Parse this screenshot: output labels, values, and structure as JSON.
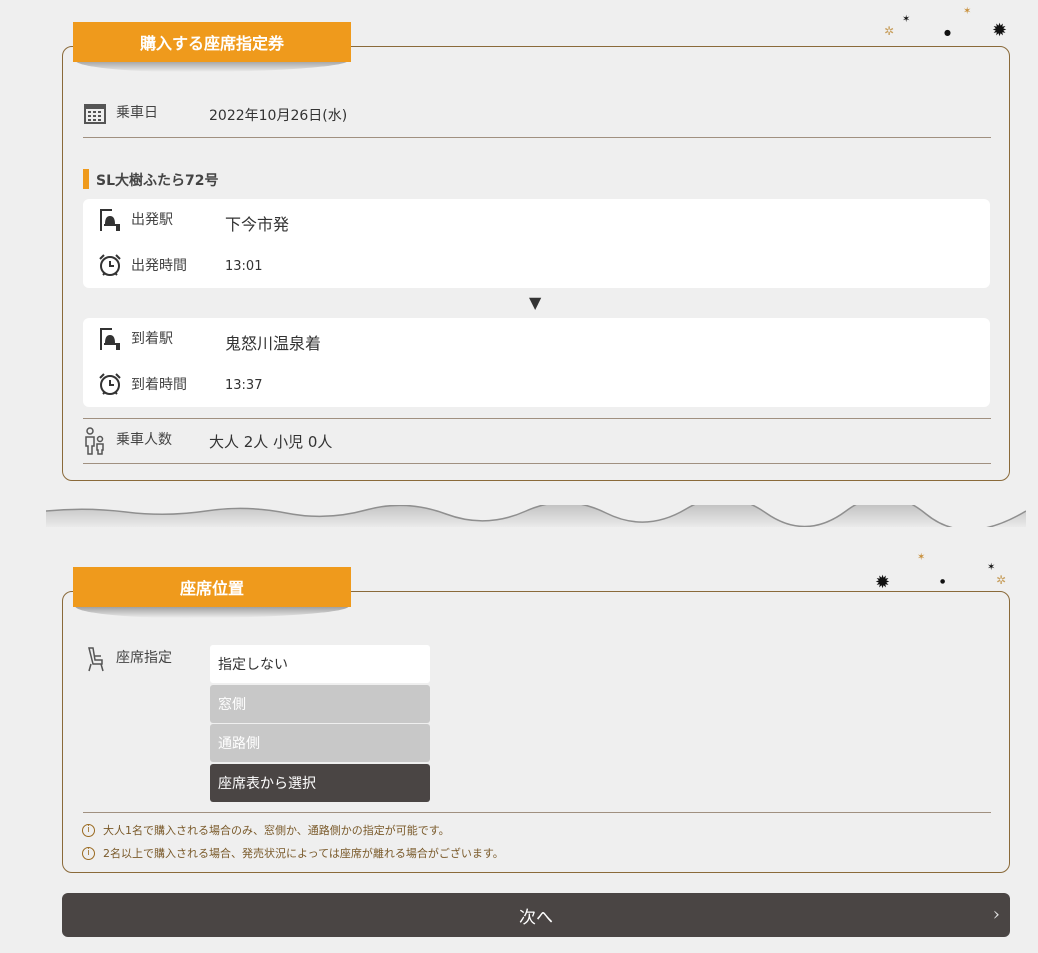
{
  "section1": {
    "tab_title": "購入する座席指定券",
    "ride_date_label": "乗車日",
    "ride_date_value": "2022年10月26日(水)",
    "train_name": "SL大樹ふたら72号",
    "departure_station_label": "出発駅",
    "departure_station_value": "下今市発",
    "departure_time_label": "出発時間",
    "departure_time_value": "13:01",
    "arrival_station_label": "到着駅",
    "arrival_station_value": "鬼怒川温泉着",
    "arrival_time_label": "到着時間",
    "arrival_time_value": "13:37",
    "passengers_label": "乗車人数",
    "passengers_value": "大人 2人 小児 0人",
    "arrow_glyph": "▼"
  },
  "section2": {
    "tab_title": "座席位置",
    "seat_label": "座席指定",
    "options": [
      {
        "label": "指定しない",
        "state": "selectable"
      },
      {
        "label": "窓側",
        "state": "disabled"
      },
      {
        "label": "通路側",
        "state": "disabled"
      },
      {
        "label": "座席表から選択",
        "state": "selected"
      }
    ],
    "notes": [
      "大人1名で購入される場合のみ、窓側か、通路側かの指定が可能です。",
      "2名以上で購入される場合、発売状況によっては座席が離れる場合がございます。"
    ],
    "info_glyph": "i"
  },
  "next_button": {
    "label": "次へ",
    "chevron": "›"
  },
  "colors": {
    "accent": "#ef9a1c",
    "border": "#8a6a3a",
    "dark": "#4a4544",
    "disabled": "#c8c8c8",
    "background": "#efefef"
  },
  "icons": [
    "calendar-icon",
    "bell-station-icon",
    "alarm-clock-icon",
    "people-icon",
    "seat-icon",
    "info-icon",
    "chevron-right-icon",
    "sparkle-icon"
  ]
}
